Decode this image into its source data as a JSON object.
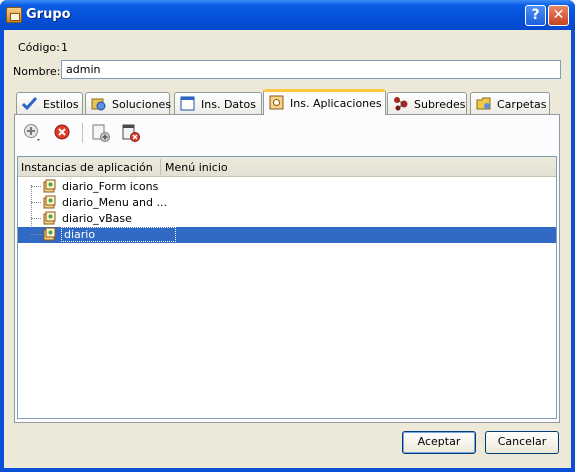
{
  "window": {
    "title": "Grupo",
    "help_glyph": "?",
    "close_glyph": "✕"
  },
  "form": {
    "codigo_label": "Código:",
    "codigo_value": "1",
    "nombre_label": "Nombre:",
    "nombre_value": "admin"
  },
  "tabs": [
    {
      "label": "Estilos",
      "icon": "checkmark-icon"
    },
    {
      "label": "Soluciones",
      "icon": "solutions-icon"
    },
    {
      "label": "Ins. Datos",
      "icon": "window-icon"
    },
    {
      "label": "Ins. Aplicaciones",
      "icon": "app-instance-icon",
      "active": true
    },
    {
      "label": "Subredes",
      "icon": "network-icon"
    },
    {
      "label": "Carpetas",
      "icon": "folder-icon"
    }
  ],
  "toolbar": {
    "buttons": [
      "add-icon",
      "remove-icon",
      "add-item-icon",
      "delete-item-icon"
    ]
  },
  "grid": {
    "columns": [
      "Instancias de aplicación",
      "Menú inicio"
    ],
    "rows": [
      {
        "name": "diario_Form icons",
        "menu": ""
      },
      {
        "name": "diario_Menu and ...",
        "menu": ""
      },
      {
        "name": "diario_vBase",
        "menu": ""
      },
      {
        "name": "diario",
        "menu": "",
        "selected": true
      }
    ]
  },
  "buttons": {
    "accept": "Aceptar",
    "cancel": "Cancelar"
  },
  "colors": {
    "title_bar": "#0550d8",
    "selection": "#316ac5",
    "tab_active_accent": "#ffc83c",
    "dialog_bg": "#ece9d8"
  }
}
